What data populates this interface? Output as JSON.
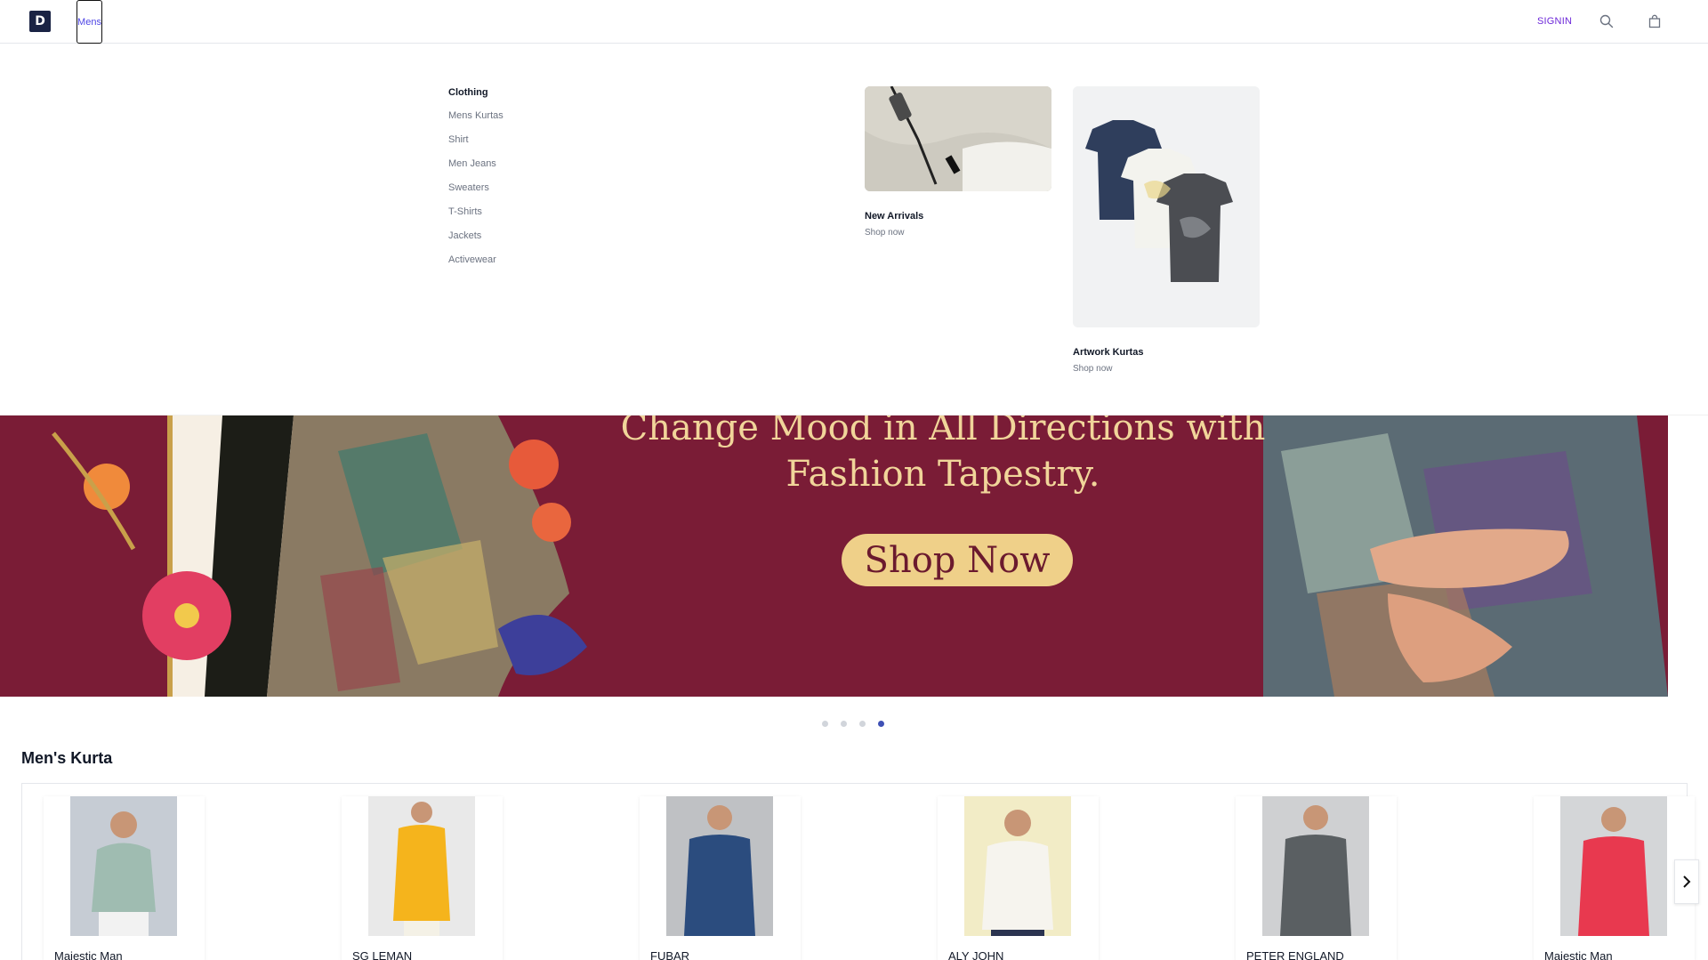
{
  "header": {
    "logo_letter": "D",
    "nav": [
      {
        "label": "Mens"
      }
    ],
    "signin_label": "SIGNIN",
    "icons": [
      "search-icon",
      "shopping-bag-icon"
    ]
  },
  "mega_menu": {
    "section_title": "Clothing",
    "items": [
      {
        "label": "Mens Kurtas"
      },
      {
        "label": "Shirt"
      },
      {
        "label": "Men Jeans"
      },
      {
        "label": "Sweaters"
      },
      {
        "label": "T-Shirts"
      },
      {
        "label": "Jackets"
      },
      {
        "label": "Activewear"
      }
    ],
    "featured": [
      {
        "title": "New Arrivals",
        "cta": "Shop now"
      },
      {
        "title": "Artwork Kurtas",
        "cta": "Shop now"
      }
    ]
  },
  "banner": {
    "headline_line1": "Change Mood in All Directions with",
    "headline_line2": "Fashion Tapestry.",
    "cta_label": "Shop Now",
    "slide_count": 4,
    "active_slide": 4,
    "colors": {
      "background": "#7a1c36",
      "text": "#f1d59a",
      "button": "#efd089"
    }
  },
  "section": {
    "title": "Men's Kurta",
    "products": [
      {
        "brand": "Majestic Man",
        "color": "#a9c4bb"
      },
      {
        "brand": "SG LEMAN",
        "color": "#f5b41c"
      },
      {
        "brand": "FUBAR",
        "color": "#2b4c7e"
      },
      {
        "brand": "ALY JOHN",
        "color": "#f4f1ea"
      },
      {
        "brand": "PETER ENGLAND",
        "color": "#5a5f62"
      },
      {
        "brand": "Majestic Man",
        "color": "#e8394f"
      }
    ]
  }
}
